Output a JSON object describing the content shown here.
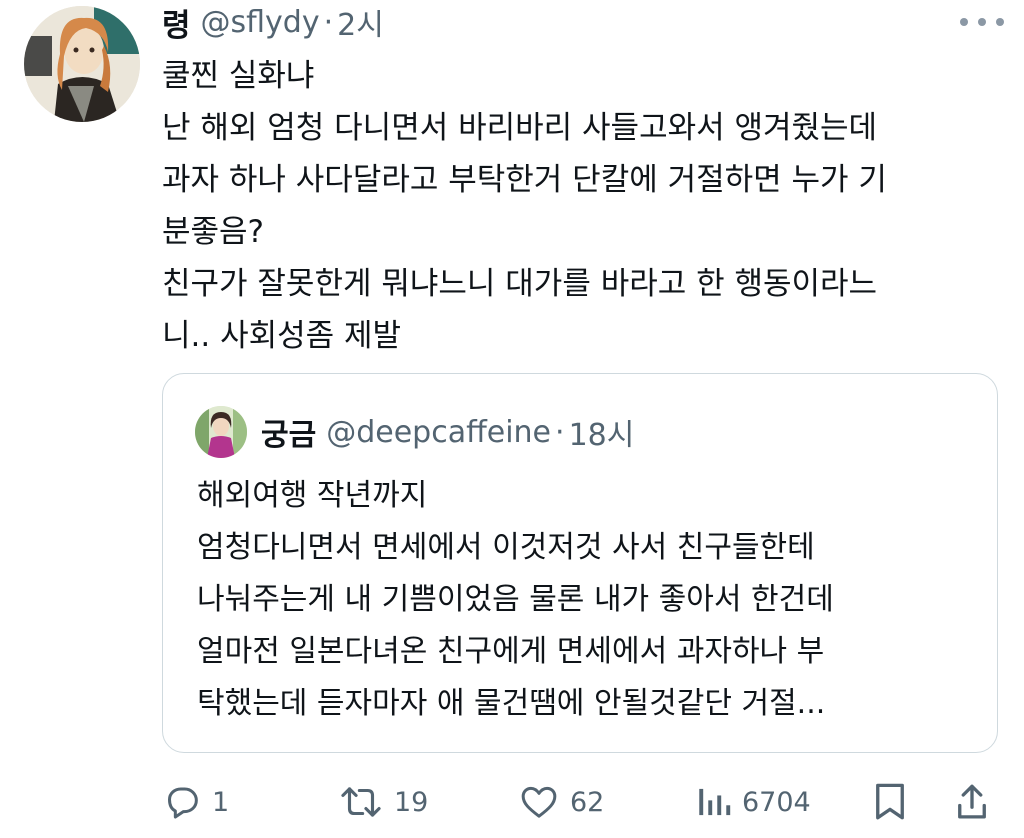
{
  "tweet": {
    "display_name": "령",
    "handle": "@sflydy",
    "separator": "·",
    "time": "2시",
    "lines": [
      "쿨찐 실화냐",
      "난 해외 엄청 다니면서 바리바리 사들고와서 앵겨줬는데",
      "과자 하나 사다달라고 부탁한거 단칼에 거절하면 누가 기",
      "분좋음?",
      "친구가 잘못한게 뭐냐느니 대가를 바라고 한 행동이라느",
      "니.. 사회성좀 제발"
    ]
  },
  "quote": {
    "display_name": "궁금",
    "handle": "@deepcaffeine",
    "separator": "·",
    "time": "18시",
    "lines": [
      "해외여행 작년까지",
      "엄청다니면서 면세에서 이것저것 사서 친구들한테",
      "나눠주는게 내 기쁨이었음 물론 내가 좋아서 한건데",
      "얼마전 일본다녀온 친구에게 면세에서 과자하나 부",
      "탁했는데 듣자마자 애 물건땜에 안될것같단 거절..."
    ]
  },
  "actions": {
    "reply": {
      "icon": "reply-icon",
      "count": "1"
    },
    "retweet": {
      "icon": "retweet-icon",
      "count": "19"
    },
    "like": {
      "icon": "heart-icon",
      "count": "62"
    },
    "views": {
      "icon": "views-icon",
      "count": "6704"
    },
    "bookmark": {
      "icon": "bookmark-icon"
    },
    "share": {
      "icon": "share-icon"
    }
  },
  "colors": {
    "text": "#0f1419",
    "secondary": "#536471",
    "border": "#cfd9de",
    "icon": "#536471"
  }
}
